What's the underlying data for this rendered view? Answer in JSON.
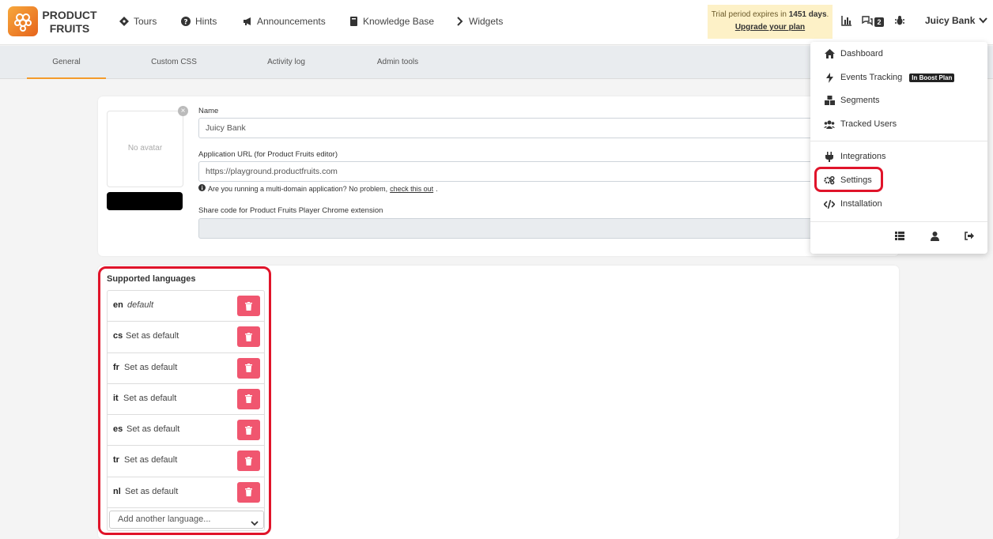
{
  "brand": {
    "line1": "PRODUCT",
    "line2": "FRUITS"
  },
  "nav": [
    {
      "label": "Tours",
      "icon": "compass-icon"
    },
    {
      "label": "Hints",
      "icon": "question-circle-icon"
    },
    {
      "label": "Announcements",
      "icon": "megaphone-icon"
    },
    {
      "label": "Knowledge Base",
      "icon": "book-icon"
    },
    {
      "label": "Widgets",
      "icon": "chevron-right-icon"
    }
  ],
  "trial": {
    "prefix": "Trial period expires in ",
    "days": "1451 days",
    "suffix": ".",
    "link": "Upgrade your plan"
  },
  "notifications": {
    "count": "2"
  },
  "account": {
    "name": "Juicy Bank"
  },
  "tabs": [
    "General",
    "Custom CSS",
    "Activity log",
    "Admin tools"
  ],
  "form": {
    "avatar_placeholder": "No avatar",
    "name_label": "Name",
    "name_value": "Juicy Bank",
    "url_label": "Application URL (for Product Fruits editor)",
    "url_value": "https://playground.productfruits.com",
    "hint_text": "Are you running a multi-domain application? No problem, ",
    "hint_link": "check this out",
    "hint_end": ".",
    "share_label": "Share code for Product Fruits Player Chrome extension",
    "share_value": ""
  },
  "languages": {
    "title": "Supported languages",
    "items": [
      {
        "code": "en",
        "action": "default"
      },
      {
        "code": "cs",
        "action": "Set as default"
      },
      {
        "code": "fr",
        "action": "Set as default"
      },
      {
        "code": "it",
        "action": "Set as default"
      },
      {
        "code": "es",
        "action": "Set as default"
      },
      {
        "code": "tr",
        "action": "Set as default"
      },
      {
        "code": "nl",
        "action": "Set as default"
      }
    ],
    "add_placeholder": "Add another language..."
  },
  "menu": {
    "items": [
      {
        "label": "Dashboard",
        "icon": "home-icon"
      },
      {
        "label": "Events Tracking",
        "icon": "bolt-icon",
        "badge": "In Boost Plan"
      },
      {
        "label": "Segments",
        "icon": "cubes-icon"
      },
      {
        "label": "Tracked Users",
        "icon": "users-icon"
      },
      {
        "label": "Integrations",
        "icon": "plug-icon"
      },
      {
        "label": "Settings",
        "icon": "cogs-icon"
      },
      {
        "label": "Installation",
        "icon": "code-icon"
      }
    ]
  },
  "colors": {
    "accent": "#f39b2b",
    "danger": "#f0566f",
    "highlight": "#e0142a",
    "trial_bg": "#fdf1c7"
  }
}
